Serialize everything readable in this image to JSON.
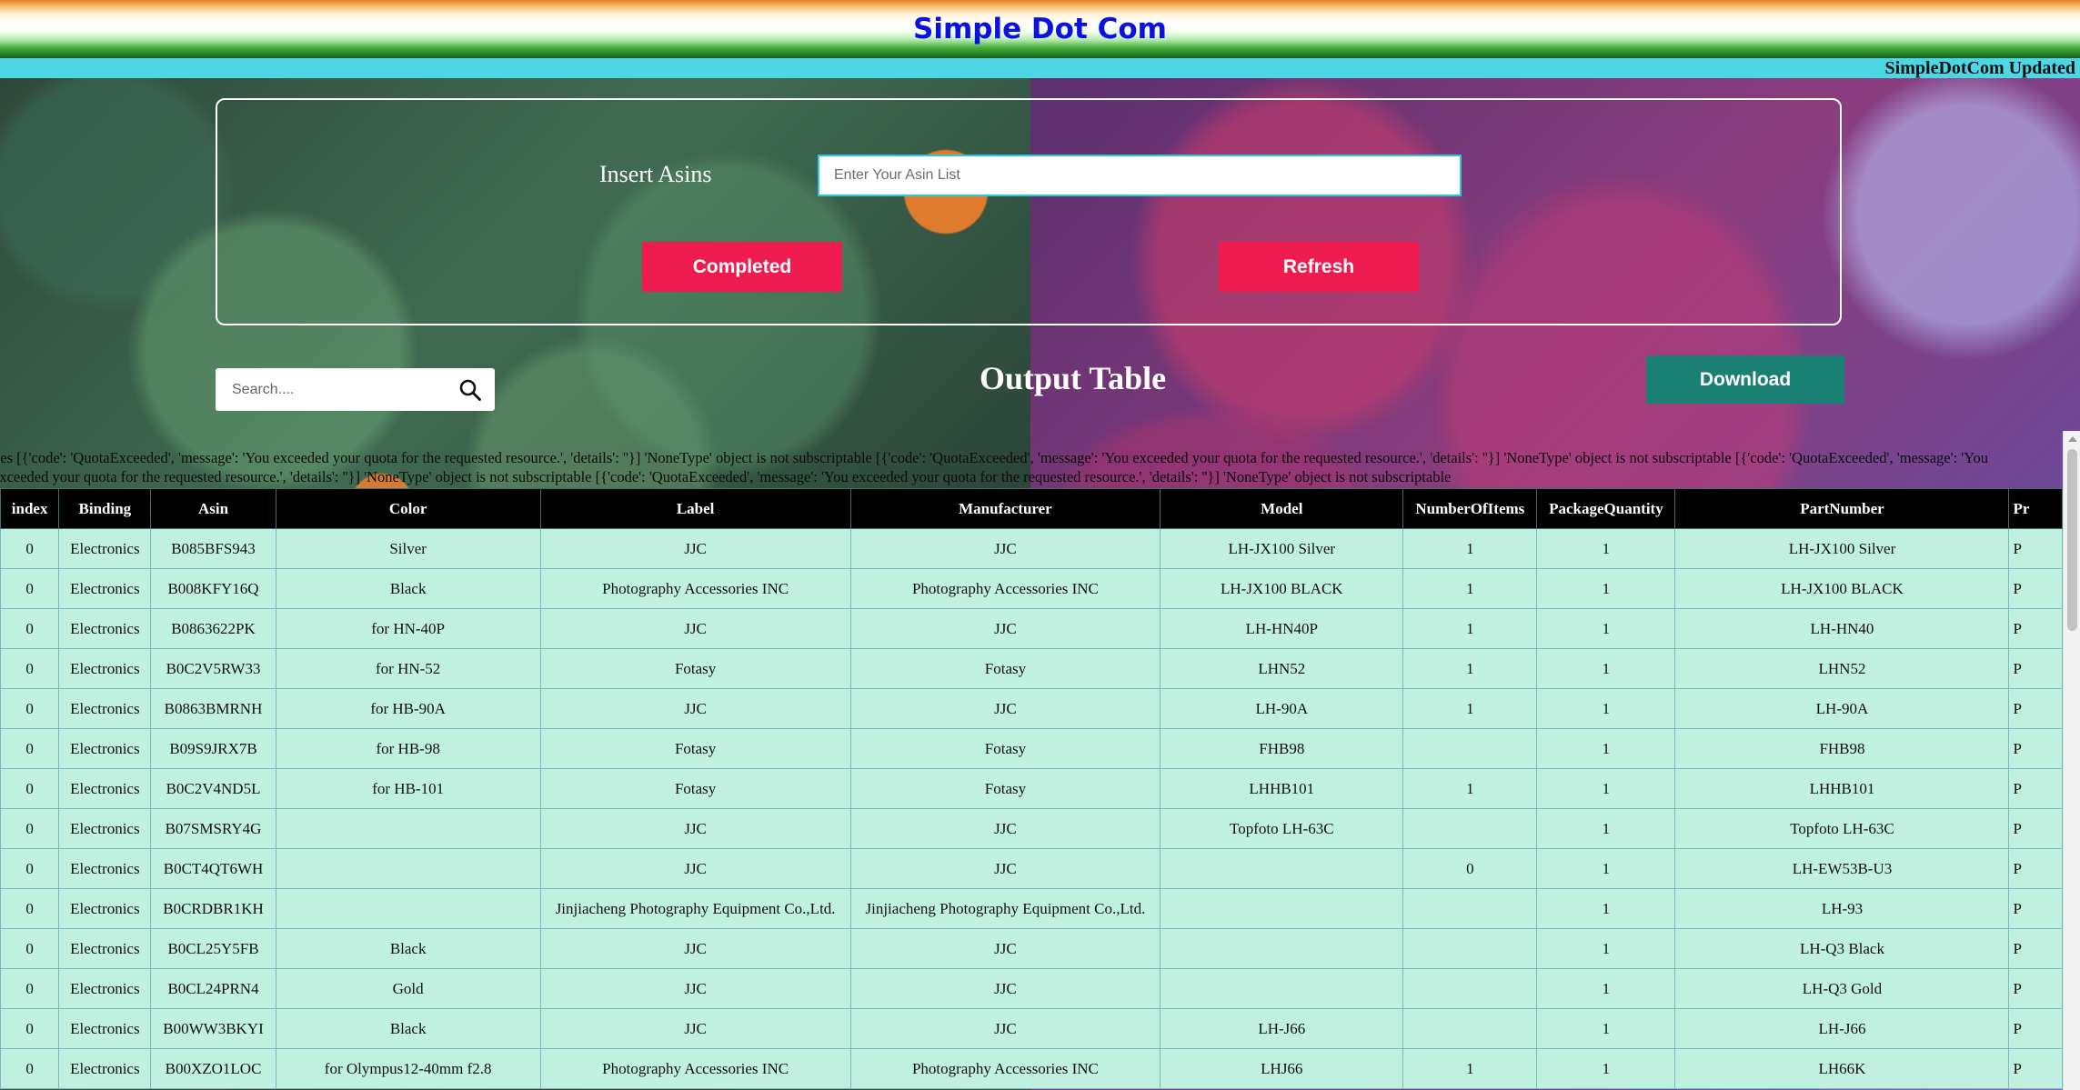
{
  "header": {
    "title": "Simple Dot Com",
    "updated_label": "SimpleDotCom Updated"
  },
  "form": {
    "insert_label": "Insert Asins",
    "asin_placeholder": "Enter Your Asin List",
    "completed_label": "Completed",
    "refresh_label": "Refresh"
  },
  "toolbar": {
    "search_placeholder": "Search....",
    "output_title": "Output Table",
    "download_label": "Download"
  },
  "error_message": "ves [{'code': 'QuotaExceeded', 'message': 'You exceeded your quota for the requested resource.', 'details': ''}] 'NoneType' object is not subscriptable [{'code': 'QuotaExceeded', 'message': 'You exceeded your quota for the requested resource.', 'details': ''}] 'NoneType' object is not subscriptable [{'code': 'QuotaExceeded', 'message': 'You exceeded your quota for the requested resource.', 'details': ''}] 'NoneType' object is not subscriptable [{'code': 'QuotaExceeded', 'message': 'You exceeded your quota for the requested resource.', 'details': ''}] 'NoneType' object is not subscriptable",
  "table": {
    "columns": [
      "index",
      "Binding",
      "Asin",
      "Color",
      "Label",
      "Manufacturer",
      "Model",
      "NumberOfItems",
      "PackageQuantity",
      "PartNumber",
      "Pr"
    ],
    "rows": [
      [
        "0",
        "Electronics",
        "B085BFS943",
        "Silver",
        "JJC",
        "JJC",
        "LH-JX100 Silver",
        "1",
        "1",
        "LH-JX100 Silver",
        "P"
      ],
      [
        "0",
        "Electronics",
        "B008KFY16Q",
        "Black",
        "Photography Accessories INC",
        "Photography Accessories INC",
        "LH-JX100 BLACK",
        "1",
        "1",
        "LH-JX100 BLACK",
        "P"
      ],
      [
        "0",
        "Electronics",
        "B0863622PK",
        "for HN-40P",
        "JJC",
        "JJC",
        "LH-HN40P",
        "1",
        "1",
        "LH-HN40",
        "P"
      ],
      [
        "0",
        "Electronics",
        "B0C2V5RW33",
        "for HN-52",
        "Fotasy",
        "Fotasy",
        "LHN52",
        "1",
        "1",
        "LHN52",
        "P"
      ],
      [
        "0",
        "Electronics",
        "B0863BMRNH",
        "for HB-90A",
        "JJC",
        "JJC",
        "LH-90A",
        "1",
        "1",
        "LH-90A",
        "P"
      ],
      [
        "0",
        "Electronics",
        "B09S9JRX7B",
        "for HB-98",
        "Fotasy",
        "Fotasy",
        "FHB98",
        "",
        "1",
        "FHB98",
        "P"
      ],
      [
        "0",
        "Electronics",
        "B0C2V4ND5L",
        "for HB-101",
        "Fotasy",
        "Fotasy",
        "LHHB101",
        "1",
        "1",
        "LHHB101",
        "P"
      ],
      [
        "0",
        "Electronics",
        "B07SMSRY4G",
        "",
        "JJC",
        "JJC",
        "Topfoto LH-63C",
        "",
        "1",
        "Topfoto LH-63C",
        "P"
      ],
      [
        "0",
        "Electronics",
        "B0CT4QT6WH",
        "",
        "JJC",
        "JJC",
        "",
        "0",
        "1",
        "LH-EW53B-U3",
        "P"
      ],
      [
        "0",
        "Electronics",
        "B0CRDBR1KH",
        "",
        "Jinjiacheng Photography Equipment Co.,Ltd.",
        "Jinjiacheng Photography Equipment Co.,Ltd.",
        "",
        "",
        "1",
        "LH-93",
        "P"
      ],
      [
        "0",
        "Electronics",
        "B0CL25Y5FB",
        "Black",
        "JJC",
        "JJC",
        "",
        "",
        "1",
        "LH-Q3 Black",
        "P"
      ],
      [
        "0",
        "Electronics",
        "B0CL24PRN4",
        "Gold",
        "JJC",
        "JJC",
        "",
        "",
        "1",
        "LH-Q3 Gold",
        "P"
      ],
      [
        "0",
        "Electronics",
        "B00WW3BKYI",
        "Black",
        "JJC",
        "JJC",
        "LH-J66",
        "",
        "1",
        "LH-J66",
        "P"
      ],
      [
        "0",
        "Electronics",
        "B00XZO1LOC",
        "for Olympus12-40mm f2.8",
        "Photography Accessories INC",
        "Photography Accessories INC",
        "LHJ66",
        "1",
        "1",
        "LH66K",
        "P"
      ]
    ]
  }
}
